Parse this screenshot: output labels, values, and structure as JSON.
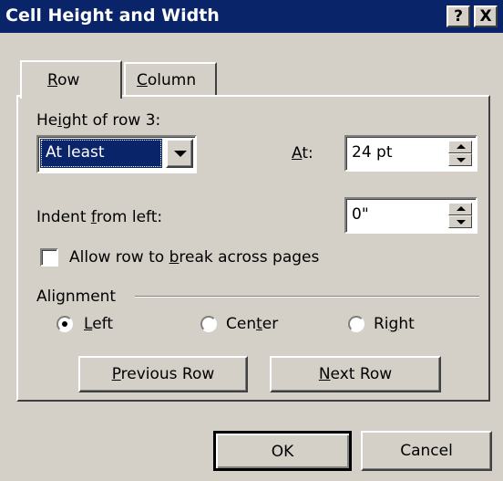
{
  "window": {
    "title": "Cell Height and Width",
    "help_label": "?",
    "close_label": "X"
  },
  "tabs": {
    "row": {
      "pre": "",
      "key": "R",
      "post": "ow"
    },
    "column": {
      "pre": "",
      "key": "C",
      "post": "olumn"
    }
  },
  "height": {
    "label": {
      "pre": "He",
      "key": "i",
      "post": "ght of row 3:"
    },
    "rule_value": "At least",
    "at_label": {
      "pre": "",
      "key": "A",
      "post": "t:"
    },
    "at_value": "24 pt"
  },
  "indent": {
    "label": {
      "pre": "Indent ",
      "key": "f",
      "post": "rom left:"
    },
    "value": "0\""
  },
  "allow_break": {
    "label": {
      "pre": "Allow row to ",
      "key": "b",
      "post": "reak across pages"
    },
    "checked": false
  },
  "alignment": {
    "group_label": "Alignment",
    "options": [
      {
        "pre": "",
        "key": "L",
        "post": "eft",
        "selected": true
      },
      {
        "pre": "Cen",
        "key": "t",
        "post": "er",
        "selected": false
      },
      {
        "pre": "Ri",
        "key": "g",
        "post": "ht",
        "selected": false
      }
    ]
  },
  "nav": {
    "previous": {
      "pre": "",
      "key": "P",
      "post": "revious Row"
    },
    "next": {
      "pre": "",
      "key": "N",
      "post": "ext Row"
    }
  },
  "footer": {
    "ok_label": "OK",
    "cancel_label": "Cancel"
  },
  "colors": {
    "title_bar": "#0a246a",
    "face": "#d4d0c8",
    "selection": "#0a246a"
  }
}
